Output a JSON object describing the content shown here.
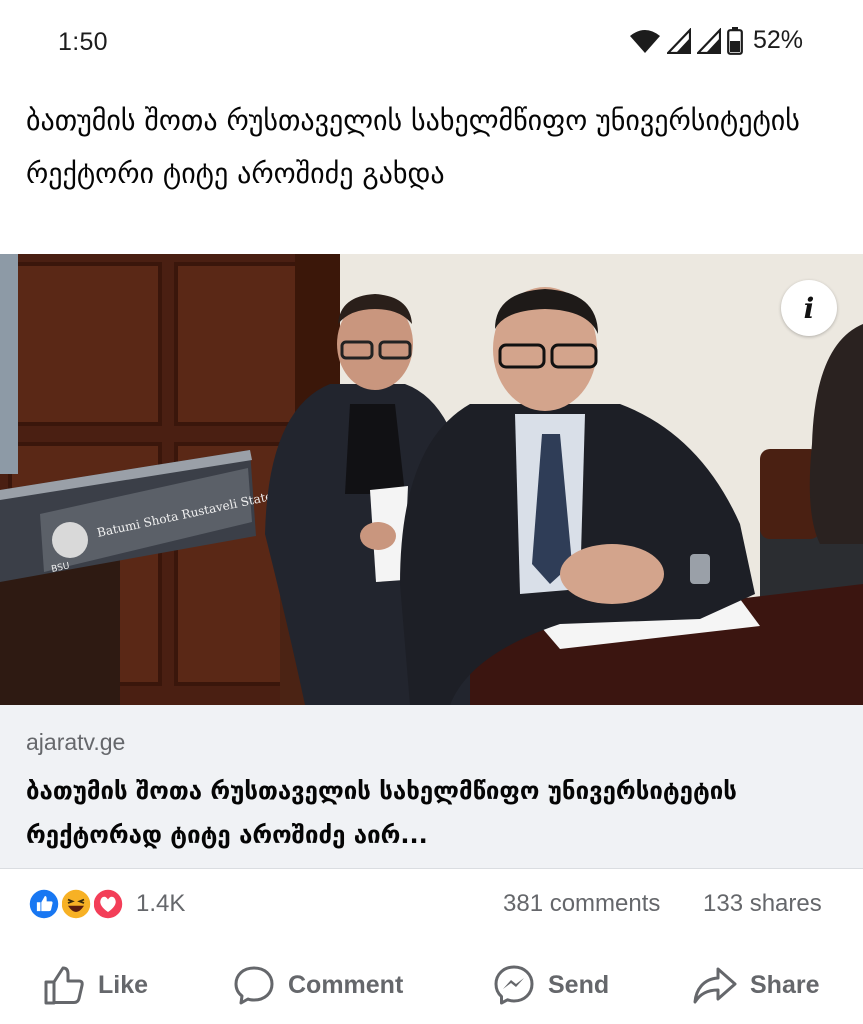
{
  "status_bar": {
    "time": "1:50",
    "battery": "52%",
    "icons": [
      "wifi-icon",
      "signal-icon",
      "signal-icon",
      "battery-icon"
    ]
  },
  "post": {
    "text": "ბათუმის შოთა რუსთაველის სახელმწიფო უნივერსიტეტის რექტორი ტიტე აროშიძე გახდა"
  },
  "photo": {
    "podium_sign_text": "Batumi Shota Rustaveli State University",
    "podium_logo_text": "BSU",
    "info_icon": "info-icon"
  },
  "link_preview": {
    "domain": "ajaratv.ge",
    "title": "ბათუმის შოთა რუსთაველის სახელმწიფო უნივერსიტეტის რექტორად ტიტე აროშიძე აირ..."
  },
  "reactions": {
    "icons": [
      "like-reaction-icon",
      "haha-reaction-icon",
      "love-reaction-icon"
    ],
    "count": "1.4K",
    "comments": "381 comments",
    "shares": "133 shares"
  },
  "actions": {
    "like": "Like",
    "comment": "Comment",
    "send": "Send",
    "share": "Share"
  },
  "colors": {
    "text_primary": "#050505",
    "text_secondary": "#65676b",
    "preview_background": "#f0f2f5",
    "like_blue": "#1877f2",
    "love_red": "#f33e58",
    "haha_yellow": "#f7b125"
  }
}
